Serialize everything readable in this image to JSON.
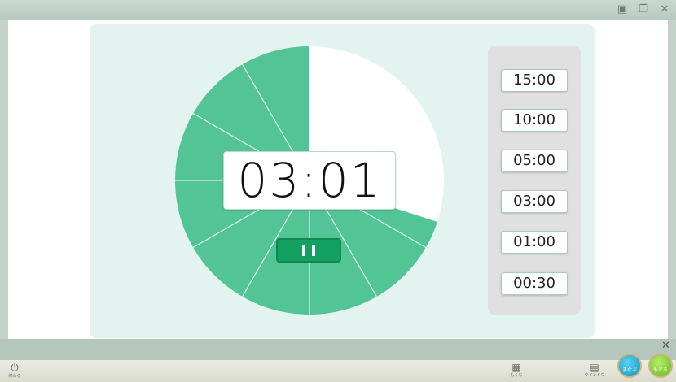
{
  "window": {
    "controls": [
      "maximize-icon",
      "restore-icon",
      "close-icon"
    ]
  },
  "timer": {
    "display": "03:01",
    "remaining_fraction": 0.7
  },
  "presets": [
    "15:00",
    "10:00",
    "05:00",
    "03:00",
    "01:00",
    "00:30"
  ],
  "taskbar": {
    "power_label": "終わる",
    "menu_label": "もくじ",
    "window_label": "ウインドウ",
    "btn1_label": "まなぶ",
    "btn2_label": "もどる"
  },
  "colors": {
    "accent": "#52c496",
    "panel": "#e3f3ef",
    "pause": "#14a060"
  }
}
